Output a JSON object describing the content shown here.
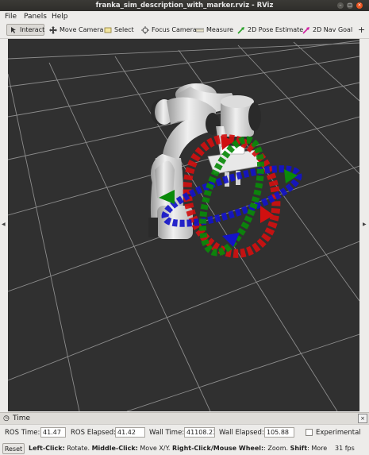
{
  "window": {
    "title": "franka_sim_description_with_marker.rviz - RViz",
    "controls": [
      "–",
      "□",
      "×"
    ]
  },
  "menu": [
    "File",
    "Panels",
    "Help"
  ],
  "toolbar": {
    "tools": [
      {
        "label": "Interact",
        "icon": "interact-icon",
        "active": true
      },
      {
        "label": "Move Camera",
        "icon": "move-camera-icon",
        "active": false
      },
      {
        "label": "Select",
        "icon": "select-icon",
        "active": false
      },
      {
        "label": "Focus Camera",
        "icon": "focus-camera-icon",
        "active": false
      },
      {
        "label": "Measure",
        "icon": "measure-icon",
        "active": false
      },
      {
        "label": "2D Pose Estimate",
        "icon": "pose-estimate-icon",
        "active": false
      },
      {
        "label": "2D Nav Goal",
        "icon": "nav-goal-icon",
        "active": false
      }
    ],
    "more": "+"
  },
  "viewport": {
    "background": "#303030",
    "grid_color": "#a0a0a0",
    "marker_colors": {
      "x": "#d01010",
      "y": "#0a8a0a",
      "z": "#1414c8"
    }
  },
  "time_panel": {
    "header": "Time",
    "ros_time_label": "ROS Time:",
    "ros_time": "41.47",
    "ros_elapsed_label": "ROS Elapsed:",
    "ros_elapsed": "41.42",
    "wall_time_label": "Wall Time:",
    "wall_time": "41108.23",
    "wall_elapsed_label": "Wall Elapsed:",
    "wall_elapsed": "105.88",
    "experimental_label": "Experimental"
  },
  "status": {
    "reset": "Reset",
    "hint_parts": [
      {
        "b": "Left-Click:",
        "t": " Rotate. "
      },
      {
        "b": "Middle-Click:",
        "t": " Move X/Y. "
      },
      {
        "b": "Right-Click/Mouse Wheel:",
        "t": ": Zoom. "
      },
      {
        "b": "Shift",
        "t": ": More opti"
      }
    ],
    "fps": "31 fps"
  }
}
